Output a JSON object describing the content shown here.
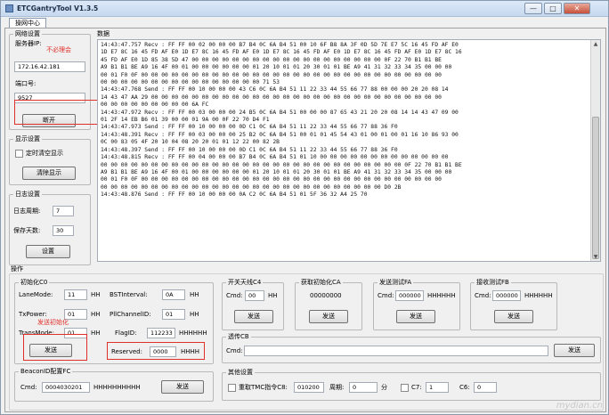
{
  "window": {
    "title": "ETCGantryTool V1.3.5",
    "min": "—",
    "max": "□",
    "close": "✕"
  },
  "tab": "操网中心",
  "network": {
    "group": "网络设置",
    "server_ip_label": "服务器IP:",
    "server_ip": "172.16.42.181",
    "port_label": "端口号:",
    "port": "9527",
    "disconnect": "断开",
    "annotation": "不必理会"
  },
  "display": {
    "group": "显示设置",
    "auto_clear_label": "定时清空显示",
    "clear_button": "清除显示"
  },
  "log_settings": {
    "group": "日志设置",
    "days_label": "日志周期:",
    "days": "7",
    "save_label": "保存天数:",
    "save_days": "30",
    "set_button": "设置"
  },
  "data": {
    "group": "数据",
    "lines": [
      "14:43:47.757 Recv : FF FF 00 02 00 00 00 B7 B4 0C 6A B4 51 00 10 6F B8 8A 3F 0D 5D 7E E7 5C 16 45 FD AF E0",
      "1D E7 8C 16 45 FD AF E0 1D E7 8C 16 45 FD AF E0 1D E7 8C 16 45 FD AF E0 1D E7 8C 16 45 FD AF E0 1D E7 8C 16",
      "45 FD AF E0 1D 85 38 5D 47 00 00 00 00 00 00 00 00 00 00 00 00 00 00 00 00 00 00 00 0F 22 70 B1 B1 BE",
      "A9 B1 B1 BE A9 16 4F 00 01 00 00 00 00 00 00 01 20 10 01 01 20 30 01 01 BE A9 41 31 32 33 34 35 00 00 00",
      "00 01 F0 0F 00 00 00 00 00 00 00 00 00 00 00 00 00 00 00 00 00 00 00 00 00 00 00 00 00 00 00 00 00 00",
      "00 00 00 00 00 00 00 00 00 00 00 00 00 00 00 00 71 53",
      "14:43:47.768 Send : FF FF 00 10 00 00 00 43 C6 0C 6A B4 51 11 22 33 44 55 66 77 88 00 00 00 20 20 08 14",
      "14 43 47 AA 29 00 00 00 00 00 00 00 00 00 00 00 00 00 00 00 00 00 00 00 00 00 00 00 00 00 00 00 00 00",
      "00 00 00 00 00 00 00 00 00 6A FC",
      "14:43:47.972 Recv : FF FF 00 03 00 00 00 24 B5 0C 6A B4 51 00 00 00 87 65 43 21 20 20 08 14 14 43 47 09 00",
      "01 2F 14 EB B6 01 39 00 00 01 9A 00 0F 22 70 D4 F1",
      "14:43:47.973 Send : FF FF 00 10 00 00 00 0D C1 0C 6A B4 51 11 22 33 44 55 66 77 88 36 F0",
      "14:43:48.391 Recv : FF FF 00 03 00 00 00 25 B2 0C 6A B4 51 00 01 01 45 54 43 01 00 01 00 01 16 10 86 93 00",
      "0C 00 83 05 4F 20 10 04 08 20 20 01 01 12 22 00 82 2B",
      "14:43:48.397 Send : FF FF 00 10 00 00 00 0D C1 0C 6A B4 51 11 22 33 44 55 66 77 88 36 F0",
      "14:43:48.815 Recv : FF FF 00 04 00 00 00 B7 B4 0C 6A B4 51 01 10 00 00 00 00 00 00 00 00 00 00 00 00 00",
      "00 00 00 00 00 00 00 00 00 00 00 00 00 00 00 00 00 00 00 00 00 00 00 00 00 00 00 00 00 00 0F 22 70 B1 B1 BE",
      "A9 B1 B1 BE A9 16 4F 00 01 00 00 00 00 00 00 01 20 10 01 01 20 30 01 01 BE A9 41 31 32 33 34 35 00 00 00",
      "00 01 F0 0F 00 00 00 00 00 00 00 00 00 00 00 00 00 00 00 00 00 00 00 00 00 00 00 00 00 00 00 00 00 00",
      "00 00 00 00 00 00 00 00 00 00 00 00 00 00 00 00 00 00 00 00 00 00 00 00 00 00 00 00 D0 2B",
      "14:43:48.876 Send : FF FF 00 10 00 00 00 0A C2 0C 6A B4 51 01 5F 36 32 A4 25 70"
    ]
  },
  "ops": {
    "group": "操作",
    "init": {
      "group": "初始化C0",
      "lane_mode_label": "LaneMode:",
      "lane_mode": "11",
      "lane_mode_unit": "HH",
      "bst_label": "BSTInterval:",
      "bst": "0A",
      "bst_unit": "HH",
      "tx_label": "TxPower:",
      "tx": "01",
      "tx_unit": "HH",
      "pll_label": "PllChannelID:",
      "pll": "01",
      "pll_unit": "HH",
      "trans_label": "TransMode:",
      "trans": "01",
      "trans_unit": "HH",
      "flag_label": "FlagID:",
      "flag": "112233",
      "flag_unit": "HHHHHH",
      "reserved_label": "Reserved:",
      "reserved": "0000",
      "reserved_unit": "HHHH",
      "send": "发送",
      "annotation": "发送初始化"
    },
    "beacon": {
      "group": "BeaconID配置FC",
      "cmd_label": "Cmd:",
      "cmd": "0004030201",
      "cmd_unit": "HHHHHHHHHH",
      "send": "发送"
    },
    "c4": {
      "group": "开关天线C4",
      "cmd_label": "Cmd:",
      "cmd": "00",
      "cmd_unit": "HH",
      "send": "发送"
    },
    "ca": {
      "group": "获取初始化CA",
      "value": "00000000",
      "send": "发送"
    },
    "fa": {
      "group": "发送测试FA",
      "cmd_label": "Cmd:",
      "cmd": "000000",
      "cmd_unit": "HHHHHH",
      "send": "发送"
    },
    "fb": {
      "group": "接收测试FB",
      "cmd_label": "Cmd:",
      "cmd": "000000",
      "cmd_unit": "HHHHHH",
      "send": "发送"
    },
    "cb": {
      "group": "透传CB",
      "cmd_label": "Cmd:",
      "cmd": "",
      "send": "发送"
    },
    "other": {
      "group": "其他设置",
      "tmc_label": "重取TMC指令C8:",
      "tmc": "010200",
      "cycle_label": "周期:",
      "cycle": "0",
      "cycle_unit": "分",
      "c7_label": "C7:",
      "c7": "1",
      "c6_label": "C6:",
      "c6": "0"
    }
  },
  "watermark": "mydian.cn"
}
